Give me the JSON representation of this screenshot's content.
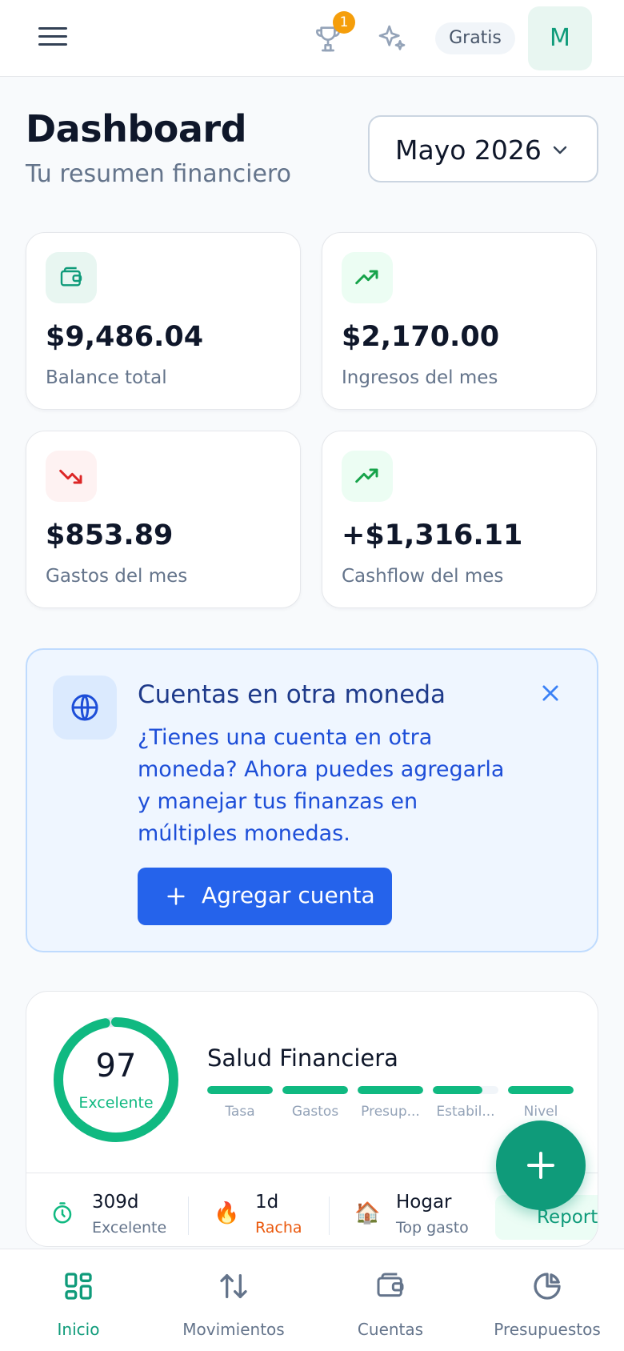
{
  "header": {
    "trophy_badge": "1",
    "plan": "Gratis",
    "avatar_initial": "M"
  },
  "page": {
    "title": "Dashboard",
    "subtitle": "Tu resumen financiero",
    "month": "Mayo 2026"
  },
  "stats": [
    {
      "amount": "$9,486.04",
      "label": "Balance total",
      "icon": "wallet-icon",
      "color": "#0f9b7a"
    },
    {
      "amount": "$2,170.00",
      "label": "Ingresos del mes",
      "icon": "trending-up-icon",
      "color": "#16a34a"
    },
    {
      "amount": "$853.89",
      "label": "Gastos del mes",
      "icon": "trending-down-icon",
      "color": "#dc2626"
    },
    {
      "amount": "+$1,316.11",
      "label": "Cashflow del mes",
      "icon": "trending-up-icon",
      "color": "#16a34a"
    }
  ],
  "banner": {
    "title": "Cuentas en otra moneda",
    "text": "¿Tienes una cuenta en otra moneda? Ahora puedes agregarla y manejar tus finanzas en múltiples monedas.",
    "cta": "Agregar cuenta"
  },
  "health": {
    "score": "97",
    "score_label": "Excelente",
    "score_fraction": 0.97,
    "title": "Salud Financiera",
    "bars": [
      {
        "label": "Tasa",
        "value": 1.0
      },
      {
        "label": "Gastos",
        "value": 1.0
      },
      {
        "label": "Presup...",
        "value": 1.0
      },
      {
        "label": "Estabil...",
        "value": 0.75
      },
      {
        "label": "Nivel",
        "value": 1.0
      }
    ],
    "metrics": [
      {
        "value": "309d",
        "label": "Excelente",
        "icon": "timer-icon"
      },
      {
        "value": "1d",
        "label": "Racha",
        "icon": "fire-icon"
      },
      {
        "value": "Hogar",
        "label": "Top gasto",
        "icon": "house-icon"
      }
    ],
    "reports": "Reportes"
  },
  "nav": [
    {
      "label": "Inicio",
      "active": true
    },
    {
      "label": "Movimientos",
      "active": false
    },
    {
      "label": "Cuentas",
      "active": false
    },
    {
      "label": "Presupuestos",
      "active": false
    }
  ],
  "colors": {
    "accent": "#0f9b7a",
    "blue": "#2563eb",
    "badge": "#f59e0b"
  }
}
